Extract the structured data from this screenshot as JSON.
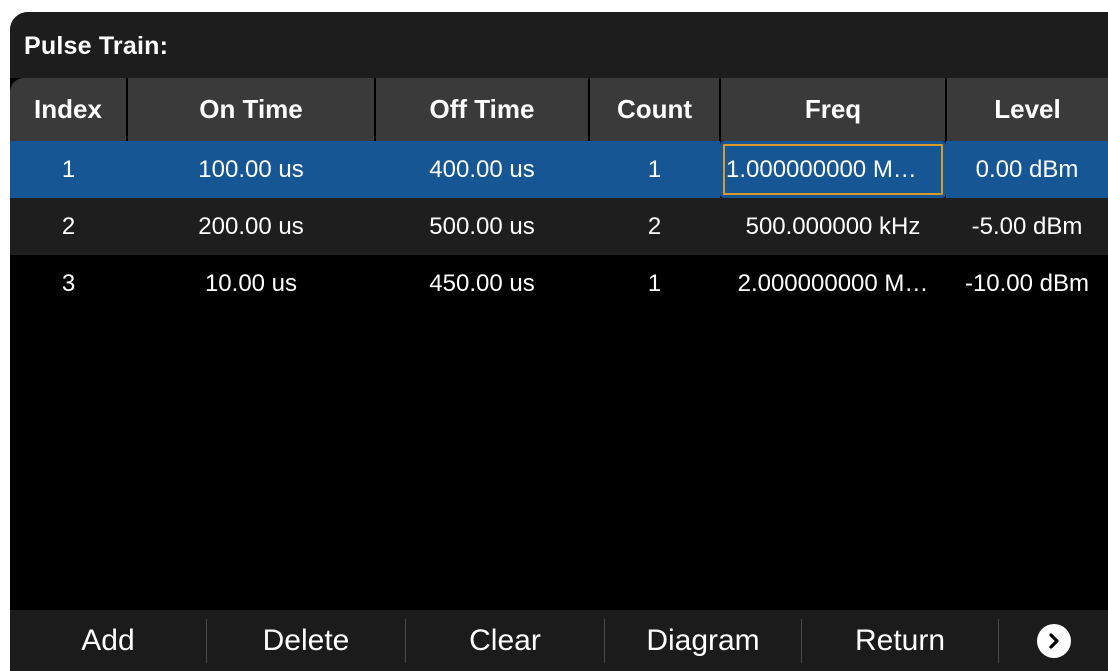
{
  "header": {
    "title": "Pulse Train:"
  },
  "table": {
    "columns": [
      "Index",
      "On Time",
      "Off Time",
      "Count",
      "Freq",
      "Level"
    ],
    "rows": [
      [
        "1",
        "100.00 us",
        "400.00 us",
        "1",
        "1.000000000 M…",
        "0.00 dBm"
      ],
      [
        "2",
        "200.00 us",
        "500.00 us",
        "2",
        "500.000000 kHz",
        "-5.00 dBm"
      ],
      [
        "3",
        "10.00 us",
        "450.00 us",
        "1",
        "2.000000000 M…",
        "-10.00 dBm"
      ]
    ],
    "selected_row": 1,
    "editing_cell": "Freq"
  },
  "toolbar": {
    "add_label": "Add",
    "delete_label": "Delete",
    "clear_label": "Clear",
    "diagram_label": "Diagram",
    "return_label": "Return",
    "next_icon": "chevron-right-circle-icon"
  },
  "colors": {
    "selection": "#165694",
    "edit_outline": "#d89a28",
    "header_bg": "#3a3a3a"
  }
}
